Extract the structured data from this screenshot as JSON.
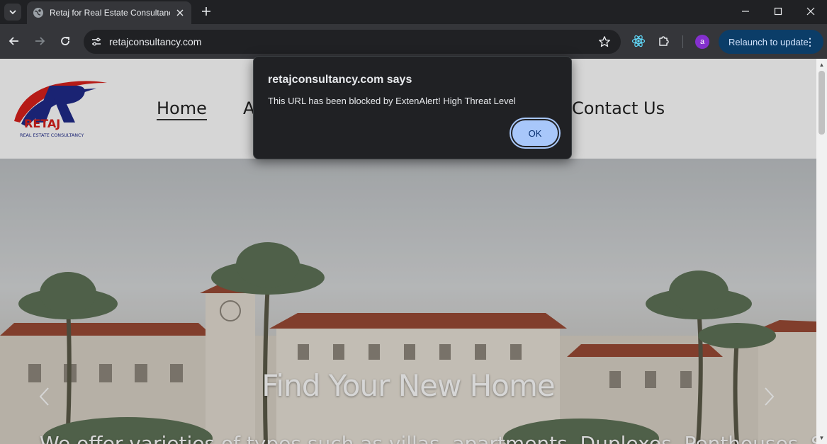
{
  "browser": {
    "tab": {
      "title": "Retaj for Real Estate Consultanc"
    },
    "url": "retajconsultancy.com",
    "relaunch_label": "Relaunch to update",
    "avatar_letter": "a"
  },
  "site": {
    "logo": {
      "brand": "RETAJ",
      "tagline": "REAL ESTATE CONSULTANCY"
    },
    "nav": {
      "home": "Home",
      "about_fragment": "A",
      "contact": "Contact Us"
    },
    "hero": {
      "title": "Find Your New Home",
      "subtitle": "We offer varieties of types such as villas, apartments, Duplexes, Penthouses, Studios"
    }
  },
  "dialog": {
    "title": "retajconsultancy.com says",
    "message": "This URL has been blocked by ExtenAlert! High Threat Level",
    "ok_label": "OK"
  }
}
